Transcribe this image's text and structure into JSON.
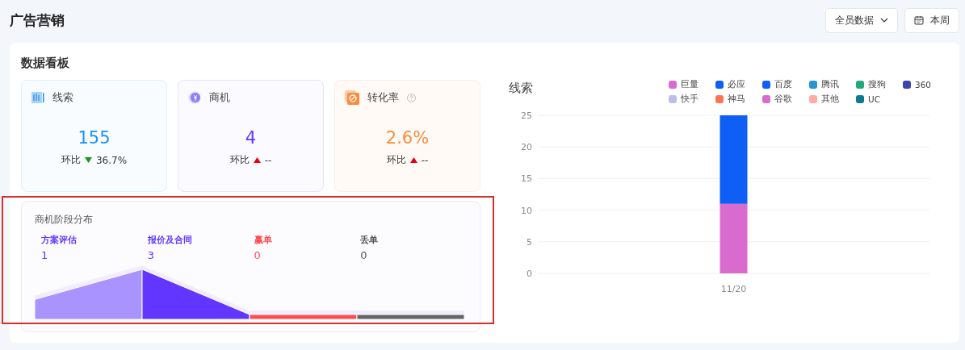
{
  "page_title": "广告营销",
  "header_controls": {
    "scope_dropdown": "全员数据",
    "date_button": "本周"
  },
  "dashboard": {
    "title": "数据看板",
    "cards": [
      {
        "kind": "leads",
        "label": "线索",
        "value": "155",
        "color": "#1890ff",
        "compare_label": "环比",
        "decrease": true,
        "change": "36.7%",
        "help": false
      },
      {
        "kind": "opportunities",
        "label": "商机",
        "value": "4",
        "color": "#6236ff",
        "compare_label": "环比",
        "decrease": false,
        "change": "--",
        "help": false
      },
      {
        "kind": "conversion",
        "label": "转化率",
        "value": "2.6%",
        "color": "#fa8c3c",
        "compare_label": "环比",
        "decrease": false,
        "change": "--",
        "help": true
      }
    ],
    "stages": {
      "title": "商机阶段分布",
      "items": [
        {
          "name": "方案评估",
          "count": "1",
          "color": "#6236ff",
          "segment": {
            "color": "#a893ff"
          }
        },
        {
          "name": "报价及合同",
          "count": "3",
          "color": "#6236ff",
          "segment": {
            "color": "#6236ff"
          }
        },
        {
          "name": "赢单",
          "count": "0",
          "color": "#ff4d4f",
          "segment": {
            "color": "#ff4d4f"
          }
        },
        {
          "name": "丢单",
          "count": "0",
          "color": "#555555",
          "segment": {
            "color": "#666666"
          }
        }
      ]
    },
    "chart": {
      "title": "线索",
      "chart_data": {
        "type": "bar",
        "stacked": true,
        "grid": true,
        "categories": [
          "11/20"
        ],
        "yticks": [
          0,
          5,
          10,
          15,
          20,
          25
        ],
        "ylim": [
          0,
          25
        ],
        "series": [
          {
            "name": "巨量",
            "color": "#da6bce",
            "values": [
              11
            ]
          },
          {
            "name": "必应",
            "color": "#0f5ef5",
            "values": [
              14
            ]
          },
          {
            "name": "百度",
            "color": "#0f5ef5",
            "values": [
              0
            ]
          },
          {
            "name": "腾讯",
            "color": "#2596d1",
            "values": [
              0
            ]
          },
          {
            "name": "搜狗",
            "color": "#20a97a",
            "values": [
              0
            ]
          },
          {
            "name": "360",
            "color": "#3d44b0",
            "values": [
              0
            ]
          },
          {
            "name": "快手",
            "color": "#bcbde8",
            "values": [
              0
            ]
          },
          {
            "name": "神马",
            "color": "#ff7351",
            "values": [
              0
            ]
          },
          {
            "name": "谷歌",
            "color": "#da6bce",
            "values": [
              0
            ]
          },
          {
            "name": "其他",
            "color": "#ffaaa5",
            "values": [
              0
            ]
          },
          {
            "name": "UC",
            "color": "#0e7a90",
            "values": [
              0
            ]
          }
        ]
      }
    }
  }
}
